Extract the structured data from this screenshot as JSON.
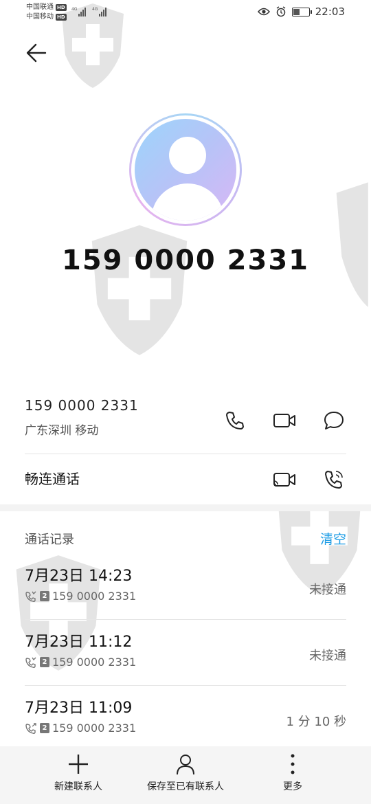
{
  "status_bar": {
    "carrier1": "中国联通",
    "carrier2": "中国移动",
    "hd": "HD",
    "network": "4G",
    "time": "22:03"
  },
  "contact": {
    "name": "159 0000 2331"
  },
  "number_card": {
    "number": "159 0000 2331",
    "location": "广东深圳 移动",
    "changlian_label": "畅连通话"
  },
  "call_log": {
    "title": "通话记录",
    "clear_label": "清空",
    "items": [
      {
        "time": "7月23日 14:23",
        "sim": "2",
        "number": "159 0000 2331",
        "status": "未接通"
      },
      {
        "time": "7月23日 11:12",
        "sim": "2",
        "number": "159 0000 2331",
        "status": "未接通"
      },
      {
        "time": "7月23日 11:09",
        "sim": "2",
        "number": "159 0000 2331",
        "status": "1 分 10 秒"
      }
    ]
  },
  "bottom_bar": {
    "new_contact": "新建联系人",
    "save_existing": "保存至已有联系人",
    "more": "更多"
  },
  "colors": {
    "accent": "#1e9de6"
  },
  "icons": [
    "back-arrow-icon",
    "phone-icon",
    "video-call-icon",
    "message-icon",
    "changlian-video-icon",
    "changlian-phone-icon",
    "plus-icon",
    "person-icon",
    "more-vertical-icon"
  ]
}
